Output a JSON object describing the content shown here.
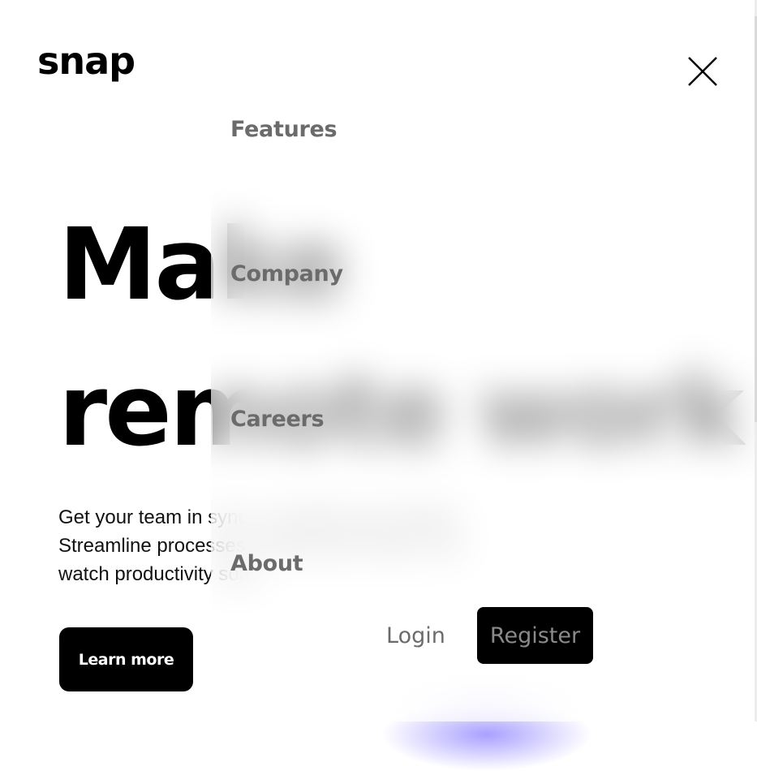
{
  "header": {
    "logo": "snap",
    "close_icon": "close-icon"
  },
  "hero": {
    "title_line1": "Make",
    "title_line2": "remote work",
    "text_line1": "Get your team in sync, no matter your location.",
    "text_line2": "Streamline processes, create team rituals, and",
    "text_line3": "watch productivity soar.",
    "cta_label": "Learn more"
  },
  "menu": {
    "items": [
      {
        "label": "Features"
      },
      {
        "label": "Company"
      },
      {
        "label": "Careers"
      },
      {
        "label": "About"
      }
    ],
    "login_label": "Login",
    "register_label": "Register"
  },
  "colors": {
    "primary": "#000000",
    "menu_text": "#6b6b6b",
    "accent_glow": "#a9a0ff"
  }
}
